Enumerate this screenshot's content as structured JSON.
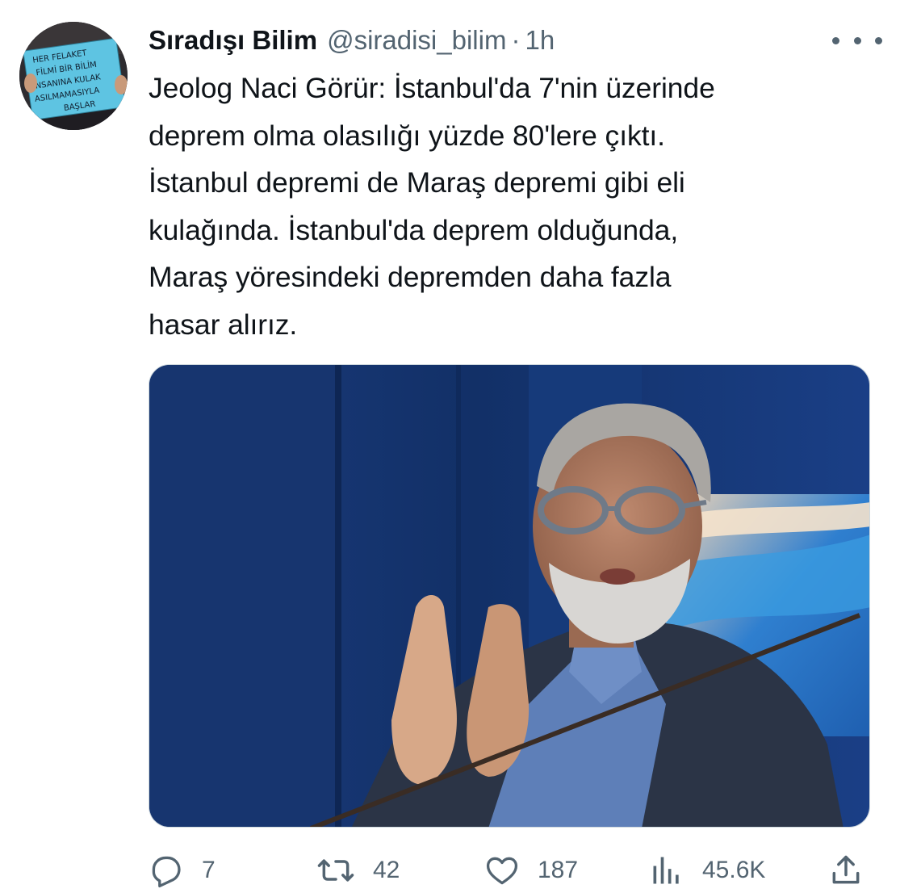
{
  "tweet": {
    "display_name": "Sıradışı Bilim",
    "handle": "@siradisi_bilim",
    "separator": "·",
    "time": "1h",
    "text": "Jeolog Naci Görür: İstanbul'da 7'nin üzerinde\ndeprem olma olasılığı yüzde 80'lere çıktı.\nİstanbul depremi de Maraş depremi gibi eli\nkulağında. İstanbul'da deprem olduğunda,\nMaraş yöresindeki depremden daha fazla\nhasar alırız.",
    "avatar": {
      "sign_text": [
        "HER FELAKET",
        "FİLMİ BİR BİLİM",
        "İNSANINA KULAK",
        "ASILMAMASIYLA",
        "BAŞLAR"
      ]
    }
  },
  "actions": {
    "replies": {
      "icon": "reply-icon",
      "count": "7"
    },
    "retweets": {
      "icon": "retweet-icon",
      "count": "42"
    },
    "likes": {
      "icon": "like-icon",
      "count": "187"
    },
    "views": {
      "icon": "views-icon",
      "count": "45.6K"
    },
    "share": {
      "icon": "share-icon"
    }
  },
  "colors": {
    "text_primary": "#0f1419",
    "text_secondary": "#536471",
    "border": "#cfd9de",
    "studio_blue": "#1a3f86"
  }
}
